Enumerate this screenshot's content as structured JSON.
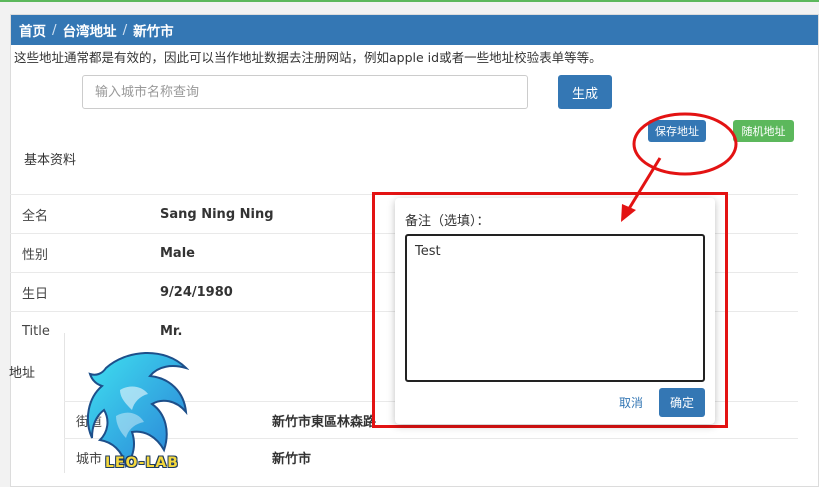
{
  "breadcrumb": {
    "home": "首页",
    "region": "台湾地址",
    "city": "新竹市"
  },
  "notice": "这些地址通常都是有效的，因此可以当作地址数据去注册网站，例如apple id或者一些地址校验表单等等。",
  "search": {
    "placeholder": "输入城市名称查询",
    "generate_label": "生成"
  },
  "actions": {
    "save_label": "保存地址",
    "random_label": "随机地址"
  },
  "basic": {
    "title": "基本资料",
    "rows": [
      {
        "label": "全名",
        "value": "Sang Ning Ning"
      },
      {
        "label": "性别",
        "value": "Male"
      },
      {
        "label": "生日",
        "value": "9/24/1980"
      },
      {
        "label": "Title",
        "value": "Mr."
      }
    ]
  },
  "address": {
    "title": "地址",
    "rows": [
      {
        "label": "街道",
        "value": "新竹市東區林森路"
      },
      {
        "label": "城市",
        "value": "新竹市"
      }
    ]
  },
  "dialog": {
    "label": "备注（选填）：",
    "textarea_value": "Test",
    "cancel_label": "取消",
    "ok_label": "确定"
  },
  "watermark": {
    "text": "LEO-LAB"
  },
  "colors": {
    "primary": "#3477b4",
    "success": "#5cb85c",
    "annotation": "#e31313"
  }
}
